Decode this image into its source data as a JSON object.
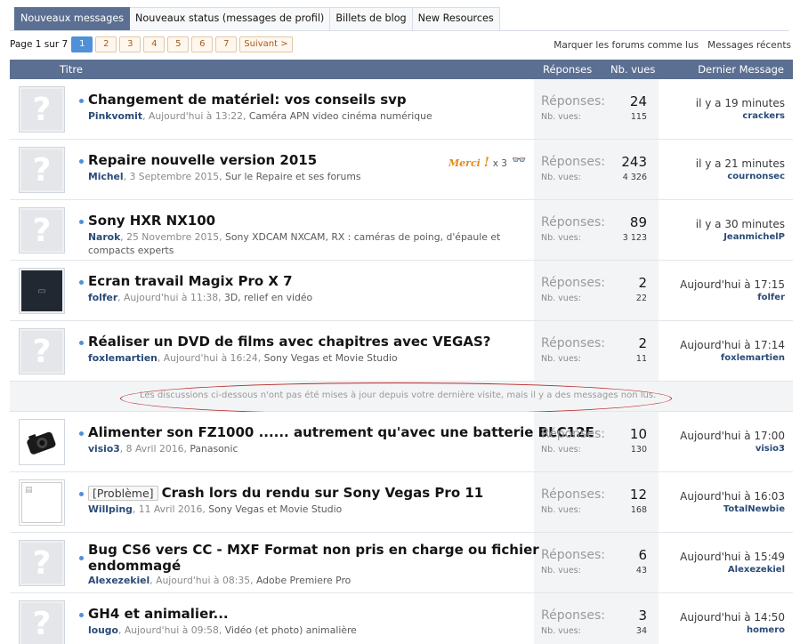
{
  "tabs": [
    {
      "label": "Nouveaux messages",
      "active": true
    },
    {
      "label": "Nouveaux status (messages de profil)",
      "active": false
    },
    {
      "label": "Billets de blog",
      "active": false
    },
    {
      "label": "New Resources",
      "active": false
    }
  ],
  "pagination": {
    "label": "Page 1 sur 7",
    "pages": [
      "1",
      "2",
      "3",
      "4",
      "5",
      "6",
      "7"
    ],
    "current": 1,
    "next_label": "Suivant >"
  },
  "forum_links": {
    "mark_read": "Marquer les forums comme lus",
    "recent": "Messages récents"
  },
  "table_header": {
    "title": "Titre",
    "replies": "Réponses",
    "views": "Nb. vues",
    "last_message": "Dernier Message"
  },
  "stat_labels": {
    "replies": "Réponses:",
    "views": "Nb. vues:"
  },
  "colors": {
    "header_bar": "#5b6f92",
    "accent_blue": "#4f90d8",
    "username": "#2a4b78",
    "highlight_oval": "#b62828"
  },
  "threads_before": [
    {
      "title": "Changement de matériel: vos conseils svp",
      "author": "Pinkvomit",
      "date": "Aujourd'hui à 13:22",
      "forum": "Caméra APN video cinéma numérique",
      "replies": "24",
      "views": "115",
      "last_time": "il y a 19 minutes",
      "last_user": "crackers",
      "avatar": "placeholder-icon"
    },
    {
      "title": "Repaire nouvelle version 2015",
      "author": "Michel",
      "date": "3 Septembre 2015",
      "forum": "Sur le Repaire et ses forums",
      "replies": "243",
      "views": "4 326",
      "last_time": "il y a 21 minutes",
      "last_user": "cournonsec",
      "avatar": "placeholder-icon",
      "merci": "Merci",
      "merci_bang": "!",
      "merci_count": "x 3"
    },
    {
      "title": "Sony HXR NX100",
      "author": "Narok",
      "date": "25 Novembre 2015",
      "forum": "Sony XDCAM NXCAM, RX : caméras de poing, d'épaule et compacts experts",
      "replies": "89",
      "views": "3 123",
      "last_time": "il y a 30 minutes",
      "last_user": "JeanmichelP",
      "avatar": "placeholder-icon"
    },
    {
      "title": "Ecran travail Magix Pro X 7",
      "author": "folfer",
      "date": "Aujourd'hui à 11:38",
      "forum": "3D, relief en vidéo",
      "replies": "2",
      "views": "22",
      "last_time": "Aujourd'hui à 17:15",
      "last_user": "folfer",
      "avatar": "screen-thumbnail"
    },
    {
      "title": "Réaliser un DVD de films avec chapitres avec VEGAS?",
      "author": "foxlemartien",
      "date": "Aujourd'hui à 16:24",
      "forum": "Sony Vegas et Movie Studio",
      "replies": "2",
      "views": "11",
      "last_time": "Aujourd'hui à 17:14",
      "last_user": "foxlemartien",
      "avatar": "placeholder-icon"
    }
  ],
  "notice": "Les discussions ci-dessous n'ont pas été mises à jour depuis votre dernière visite, mais il y a des messages non lus.",
  "threads_after": [
    {
      "title": "Alimenter son FZ1000 ...... autrement qu'avec une batterie BLC12E",
      "author": "visio3",
      "date": "8 Avril 2016",
      "forum": "Panasonic",
      "replies": "10",
      "views": "130",
      "last_time": "Aujourd'hui à 17:00",
      "last_user": "visio3",
      "avatar": "camera-avatar"
    },
    {
      "prefix": "[Problème]",
      "title": "Crash lors du rendu sur Sony Vegas Pro 11",
      "author": "Willping",
      "date": "11 Avril 2016",
      "forum": "Sony Vegas et Movie Studio",
      "replies": "12",
      "views": "168",
      "last_time": "Aujourd'hui à 16:03",
      "last_user": "TotalNewbie",
      "avatar": "broken-image"
    },
    {
      "title": "Bug CS6 vers CC - MXF Format non pris en charge ou fichier",
      "title2": "endommagé",
      "author": "Alexezekiel",
      "date": "Aujourd'hui à 08:35",
      "forum": "Adobe Premiere Pro",
      "replies": "6",
      "views": "43",
      "last_time": "Aujourd'hui à 15:49",
      "last_user": "Alexezekiel",
      "avatar": "placeholder-icon"
    },
    {
      "title": "GH4 et animalier...",
      "author": "lougo",
      "date": "Aujourd'hui à 09:58",
      "forum": "Vidéo (et photo) animalière",
      "replies": "3",
      "views": "34",
      "last_time": "Aujourd'hui à 14:50",
      "last_user": "homero",
      "avatar": "placeholder-icon"
    }
  ]
}
